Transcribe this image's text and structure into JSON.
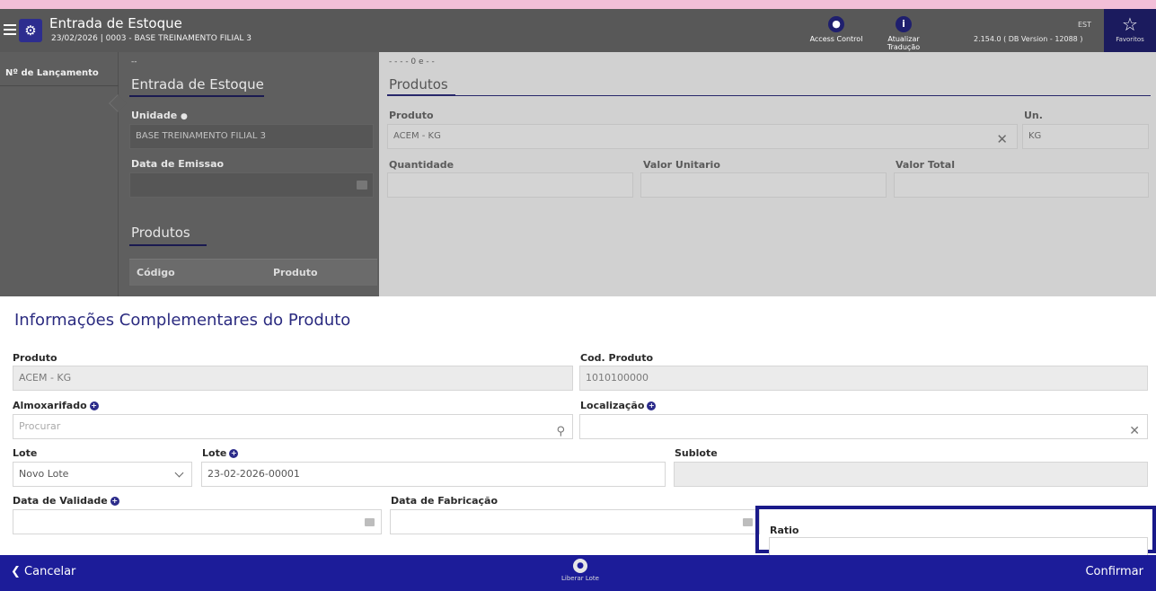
{
  "header": {
    "title": "Entrada de Estoque",
    "subtitle": "23/02/2026 | 0003 - BASE TREINAMENTO FILIAL 3",
    "access_control_label": "Access Control",
    "atualizar_traducao_label": "Atualizar Tradução",
    "est_label": "EST",
    "version": "2.154.0 ( DB Version - 12088 )",
    "favoritos_label": "Favoritos"
  },
  "left_column": {
    "header": "Nº de Lançamento"
  },
  "entrada_panel": {
    "dots": "--",
    "title": "Entrada de Estoque",
    "unidade_label": "Unidade",
    "unidade_value": "BASE TREINAMENTO FILIAL 3",
    "data_emissao_label": "Data de Emissao",
    "produtos_title": "Produtos",
    "table_headers": [
      "Código",
      "Produto"
    ]
  },
  "produtos_panel": {
    "dots": "- - - - 0 e - -",
    "title": "Produtos",
    "produto_label": "Produto",
    "produto_value": "ACEM - KG",
    "un_label": "Un.",
    "un_value": "KG",
    "quantidade_label": "Quantidade",
    "valor_unitario_label": "Valor Unitario",
    "valor_total_label": "Valor Total"
  },
  "info": {
    "title": "Informações Complementares do Produto",
    "produto_label": "Produto",
    "produto_value": "ACEM - KG",
    "cod_produto_label": "Cod. Produto",
    "cod_produto_value": "1010100000",
    "almoxarifado_label": "Almoxarifado",
    "almoxarifado_placeholder": "Procurar",
    "localizacao_label": "Localização",
    "lote_select_label": "Lote",
    "lote_select_value": "Novo Lote",
    "lote_label": "Lote",
    "lote_value": "23-02-2026-00001",
    "sublote_label": "Sublote",
    "data_validade_label": "Data de Validade",
    "data_fabricacao_label": "Data de Fabricação",
    "ratio_label": "Ratio"
  },
  "footer": {
    "cancel_label": "Cancelar",
    "liberar_label": "Liberar Lote",
    "confirm_label": "Confirmar"
  },
  "colors": {
    "header_bg": "#585858",
    "accent": "#1c1c99",
    "highlight": "#1a1a8a",
    "pink_bar": "#f2bfd8"
  }
}
